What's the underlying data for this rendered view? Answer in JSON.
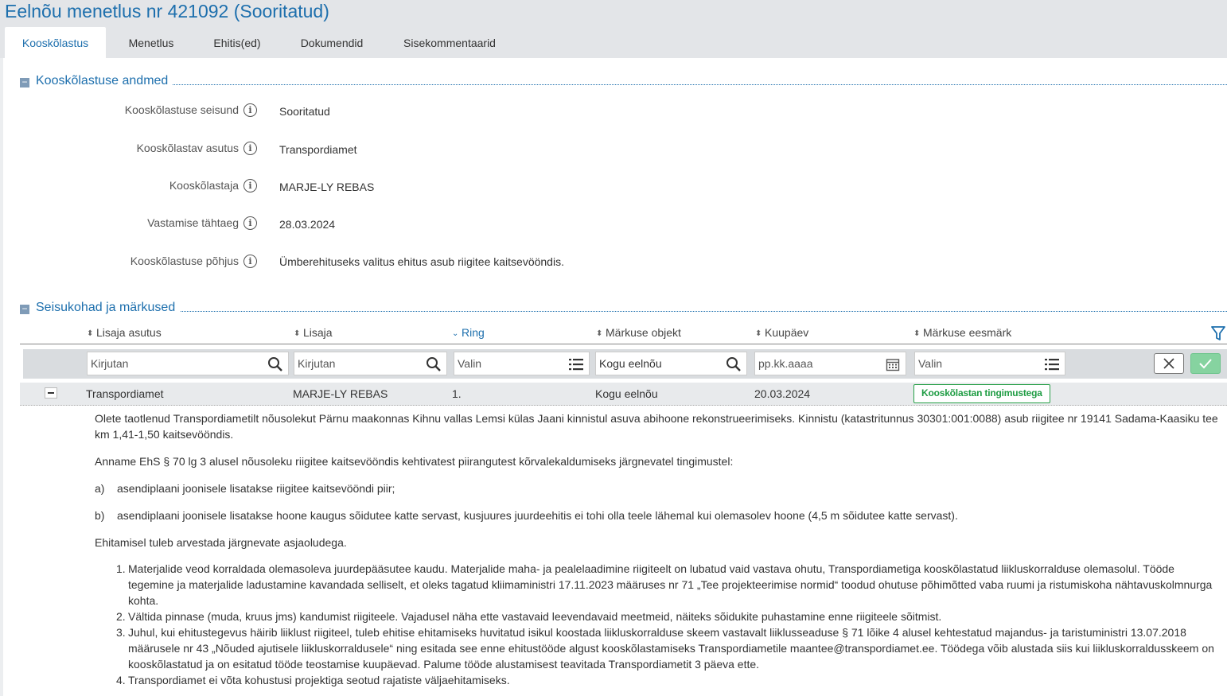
{
  "page": {
    "title": "Eelnõu menetlus nr 421092 (Sooritatud)"
  },
  "tabs": [
    {
      "label": "Kooskõlastus",
      "active": true
    },
    {
      "label": "Menetlus",
      "active": false
    },
    {
      "label": "Ehitis(ed)",
      "active": false
    },
    {
      "label": "Dokumendid",
      "active": false
    },
    {
      "label": "Sisekommentaarid",
      "active": false
    }
  ],
  "section1": {
    "title": "Kooskõlastuse andmed",
    "toggle_icon": "minus-icon",
    "fields": [
      {
        "label": "Kooskõlastuse seisund",
        "value": "Sooritatud"
      },
      {
        "label": "Kooskõlastav asutus",
        "value": "Transpordiamet"
      },
      {
        "label": "Kooskõlastaja",
        "value": "MARJE-LY REBAS"
      },
      {
        "label": "Vastamise tähtaeg",
        "value": "28.03.2024"
      },
      {
        "label": "Kooskõlastuse põhjus",
        "value": "Ümberehituseks valitus ehitus asub riigitee kaitsevööndis."
      }
    ]
  },
  "section2": {
    "title": "Seisukohad ja märkused",
    "columns": [
      "Lisaja asutus",
      "Lisaja",
      "Ring",
      "Märkuse objekt",
      "Kuupäev",
      "Märkuse eesmärk"
    ],
    "filters": [
      {
        "placeholder": "Kirjutan",
        "value": "",
        "icon": "search-icon"
      },
      {
        "placeholder": "Kirjutan",
        "value": "",
        "icon": "search-icon"
      },
      {
        "placeholder": "Valin",
        "value": "",
        "icon": "list-icon"
      },
      {
        "placeholder": "",
        "value": "Kogu eelnõu",
        "icon": "search-icon"
      },
      {
        "placeholder": "pp.kk.aaaa",
        "value": "",
        "icon": "calendar-icon"
      },
      {
        "placeholder": "Valin",
        "value": "",
        "icon": "list-icon"
      }
    ],
    "row": {
      "asutus": "Transpordiamet",
      "lisaja": "MARJE-LY REBAS",
      "ring": "1.",
      "objekt": "Kogu eelnõu",
      "kuupaev": "20.03.2024",
      "eesmark": "Kooskõlastan tingimustega"
    },
    "detail": {
      "p1": "Olete taotlenud Transpordiametilt nõusolekut Pärnu maakonnas Kihnu vallas Lemsi külas Jaani kinnistul asuva abihoone rekonstrueerimiseks. Kinnistu (katastritunnus 30301:001:0088) asub riigitee nr 19141 Sadama-Kaasiku tee km 1,41-1,50 kaitsevööndis.",
      "p2": "Anname EhS § 70 lg 3 alusel nõusoleku riigitee kaitsevööndis kehtivatest piirangutest kõrvalekaldumiseks järgnevatel tingimustel:",
      "a_label": "a)",
      "a_text": "asendiplaani joonisele lisatakse riigitee kaitsevööndi piir;",
      "b_label": "b)",
      "b_text": "asendiplaani joonisele lisatakse hoone kaugus sõidutee katte servast, kusjuures juurdeehitis ei tohi olla teele lähemal kui olemasolev hoone (4,5 m sõidutee katte servast).",
      "p3": "Ehitamisel tuleb arvestada järgnevate asjaoludega.",
      "items": [
        {
          "num": "1.",
          "text": "Materjalide veod korraldada olemasoleva juurdepääsutee kaudu. Materjalide maha- ja pealelaadimine riigiteelt on lubatud vaid vastava ohutu, Transpordiametiga kooskõlastatud liikluskorralduse olemasolul. Tööde tegemine ja materjalide ladustamine kavandada selliselt, et oleks tagatud kliimaministri 17.11.2023 määruses nr 71 „Tee projekteerimise normid“ toodud ohutuse põhimõtted vaba ruumi ja ristumiskoha nähtavuskolmnurga kohta."
        },
        {
          "num": "2.",
          "text": "Vältida pinnase (muda, kruus jms) kandumist riigiteele. Vajadusel näha ette vastavaid leevendavaid meetmeid, näiteks sõidukite puhastamine enne riigiteele sõitmist."
        },
        {
          "num": "3.",
          "text": "Juhul, kui ehitustegevus häirib liiklust riigiteel, tuleb ehitise ehitamiseks huvitatud isikul koostada liikluskorralduse skeem vastavalt liiklusseaduse § 71 lõike 4 alusel kehtestatud majandus- ja taristuministri 13.07.2018 määrusele nr 43 „Nõuded ajutisele liikluskorraldusele“ ning esitada see enne ehitustööde algust kooskõlastamiseks Transpordiametile maantee@transpordiamet.ee. Töödega võib alustada siis kui liikluskorraldusskeem on kooskõlastatud ja on esitatud tööde teostamise kuupäevad. Palume tööde alustamisest teavitada Transpordiametit 3 päeva ette."
        },
        {
          "num": "4.",
          "text": "Transpordiamet ei võta kohustusi projektiga seotud rajatiste väljaehitamiseks."
        }
      ]
    }
  },
  "colors": {
    "accent": "#1d6fad",
    "badge_green": "#27a048",
    "ok_button": "#86d3a0"
  }
}
